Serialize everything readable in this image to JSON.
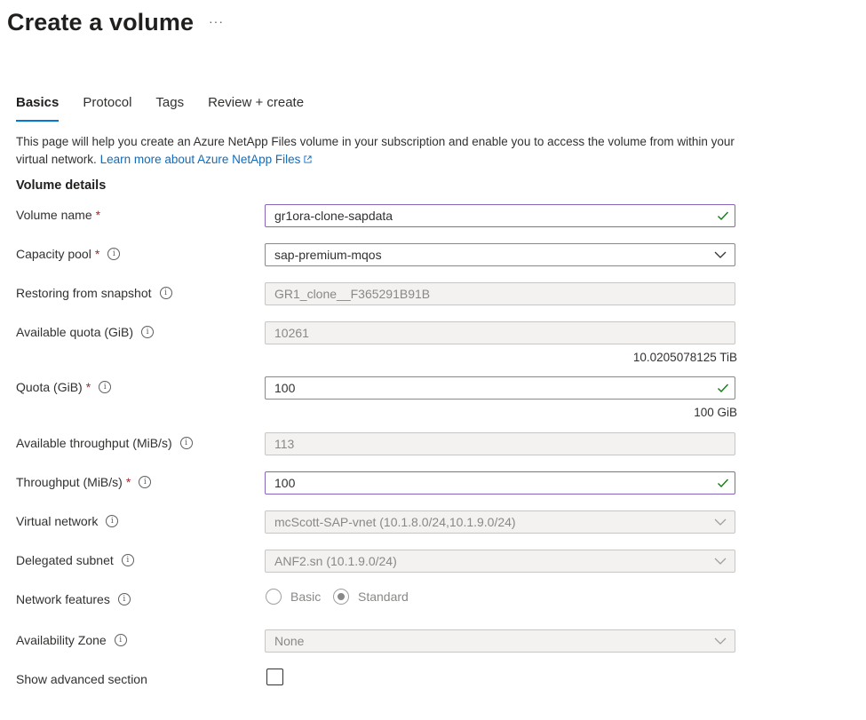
{
  "header": {
    "title": "Create a volume",
    "more": "···"
  },
  "tabs": [
    {
      "label": "Basics",
      "active": true
    },
    {
      "label": "Protocol",
      "active": false
    },
    {
      "label": "Tags",
      "active": false
    },
    {
      "label": "Review + create",
      "active": false
    }
  ],
  "intro": {
    "text": "This page will help you create an Azure NetApp Files volume in your subscription and enable you to access the volume from within your virtual network.",
    "link": "Learn more about Azure NetApp Files"
  },
  "section_title": "Volume details",
  "fields": {
    "volume_name": {
      "label": "Volume name",
      "required": "*",
      "value": "gr1ora-clone-sapdata"
    },
    "capacity_pool": {
      "label": "Capacity pool",
      "required": "*",
      "value": "sap-premium-mqos"
    },
    "restoring": {
      "label": "Restoring from snapshot",
      "value": "GR1_clone__F365291B91B"
    },
    "available_quota": {
      "label": "Available quota (GiB)",
      "value": "10261",
      "hint": "10.0205078125 TiB"
    },
    "quota": {
      "label": "Quota (GiB)",
      "required": "*",
      "value": "100",
      "hint": "100 GiB"
    },
    "available_throughput": {
      "label": "Available throughput (MiB/s)",
      "value": "113"
    },
    "throughput": {
      "label": "Throughput (MiB/s)",
      "required": "*",
      "value": "100"
    },
    "virtual_network": {
      "label": "Virtual network",
      "value": "mcScott-SAP-vnet (10.1.8.0/24,10.1.9.0/24)"
    },
    "delegated_subnet": {
      "label": "Delegated subnet",
      "value": "ANF2.sn (10.1.9.0/24)"
    },
    "network_features": {
      "label": "Network features",
      "options": [
        "Basic",
        "Standard"
      ],
      "selected": "Standard"
    },
    "availability_zone": {
      "label": "Availability Zone",
      "value": "None"
    },
    "show_advanced": {
      "label": "Show advanced section",
      "checked": false
    }
  },
  "colors": {
    "accent": "#0078d4",
    "link": "#0f6cbd",
    "valid_check": "#107c10",
    "active_border": "#8764b8",
    "required": "#a4262c"
  }
}
